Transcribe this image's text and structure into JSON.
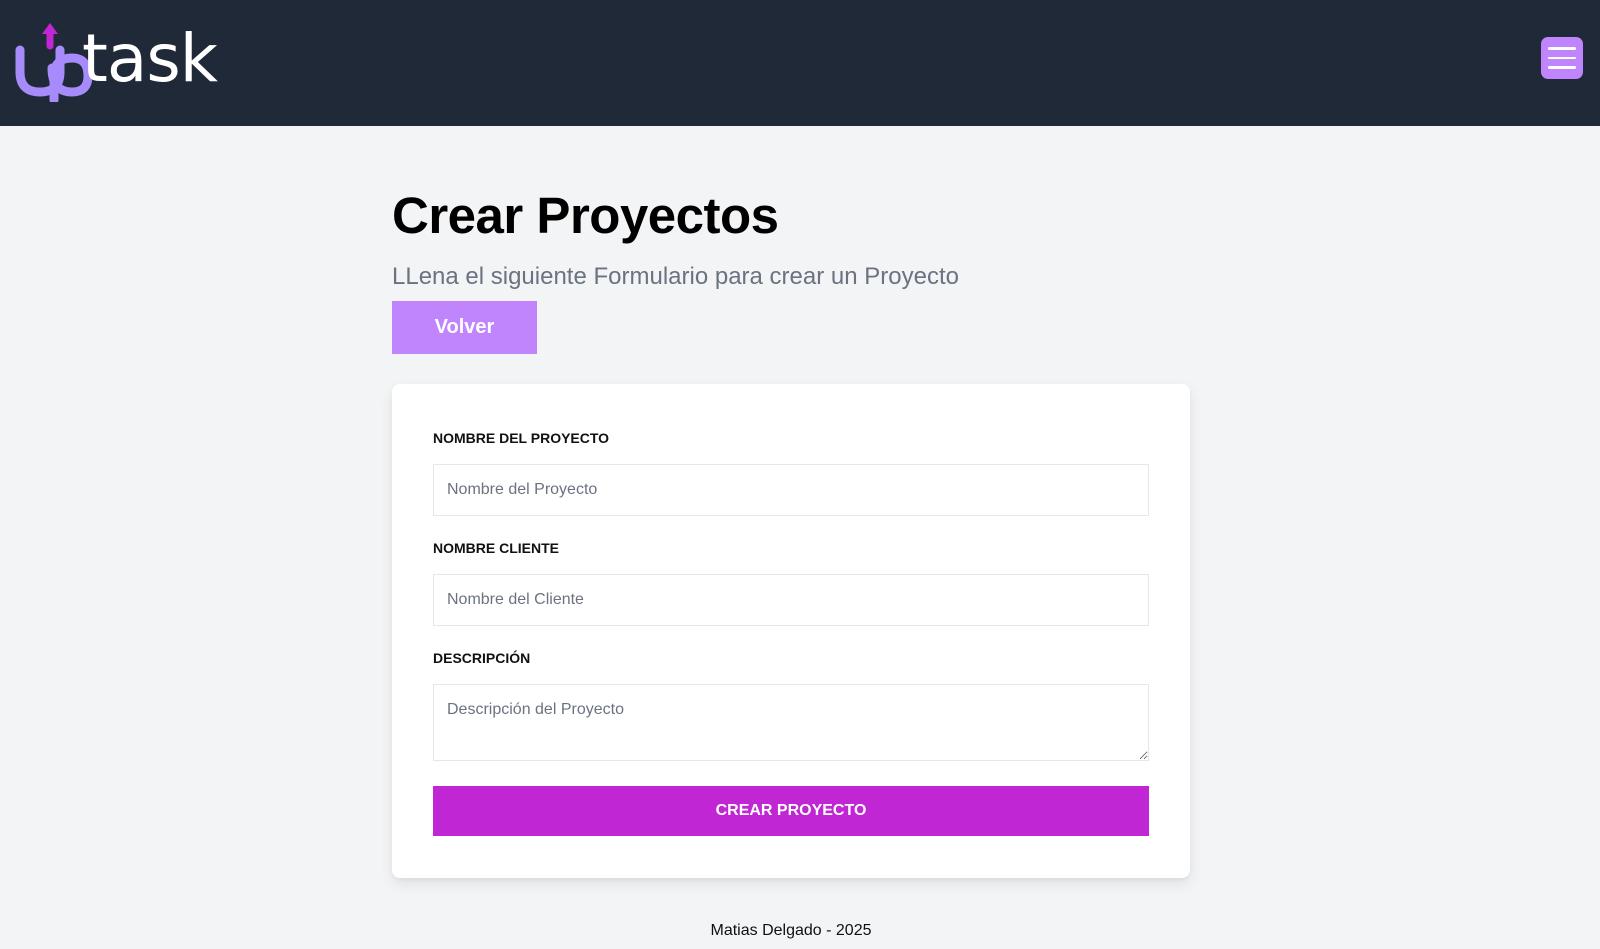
{
  "header": {
    "logo": {
      "text": "uptask",
      "alt": "uptask"
    },
    "menu_icon": "hamburger-menu-icon"
  },
  "page": {
    "title": "Crear Proyectos",
    "subtitle": "LLena el siguiente Formulario para crear un Proyecto",
    "back_label": "Volver"
  },
  "form": {
    "project_name": {
      "label": "Nombre del Proyecto",
      "placeholder": "Nombre del Proyecto",
      "value": ""
    },
    "client_name": {
      "label": "Nombre Cliente",
      "placeholder": "Nombre del Cliente",
      "value": ""
    },
    "description": {
      "label": "Descripción",
      "placeholder": "Descripción del Proyecto",
      "value": ""
    },
    "submit_label": "Crear Proyecto"
  },
  "footer": {
    "text": "Matias Delgado - 2025"
  },
  "colors": {
    "header_bg": "#1f2937",
    "page_bg": "#f3f4f6",
    "accent_light": "#c084fc",
    "accent_strong": "#c026d3",
    "logo_arrow": "#c026d3"
  }
}
